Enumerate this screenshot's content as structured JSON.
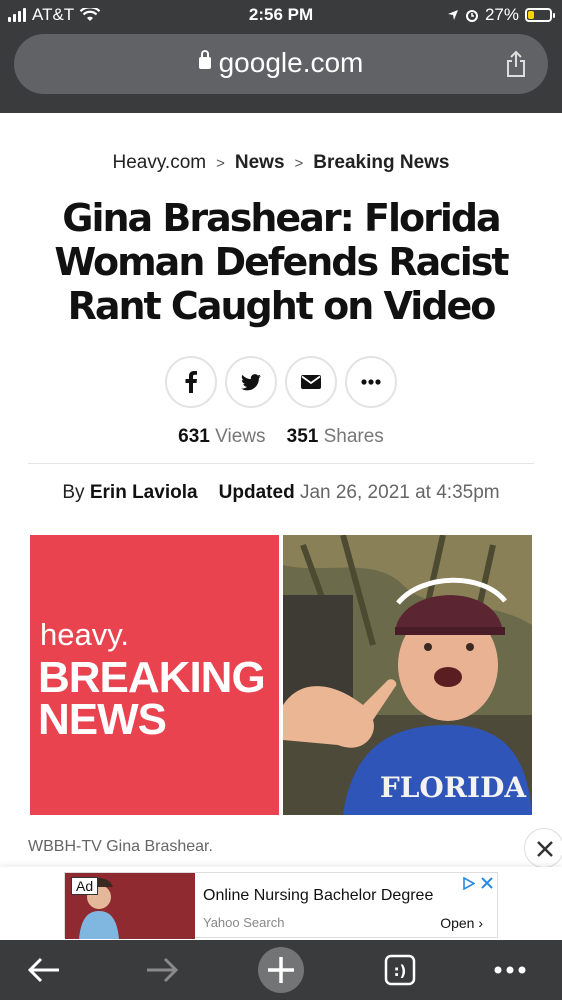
{
  "status_bar": {
    "carrier": "AT&T",
    "time": "2:56 PM",
    "battery": "27%",
    "battery_level": 0.27
  },
  "url_bar": {
    "domain": "google.com"
  },
  "article": {
    "breadcrumb": [
      "Heavy.com",
      "News",
      "Breaking News"
    ],
    "title": "Gina Brashear: Florida Woman Defends Racist Rant Caught on Video",
    "views_count": "631",
    "views_label": "Views",
    "shares_count": "351",
    "shares_label": "Shares",
    "by_label": "By",
    "author": "Erin Laviola",
    "updated_label": "Updated",
    "updated_date": "Jan 26, 2021 at 4:35pm",
    "image_left": {
      "brand": "heavy.",
      "line1": "BREAKING",
      "line2": "NEWS"
    },
    "image_right_shirt_text": "FLORIDA",
    "caption": "WBBH-TV Gina Brashear."
  },
  "ad": {
    "badge": "Ad",
    "title": "Online Nursing Bachelor Degree",
    "source": "Yahoo Search",
    "open_label": "Open"
  },
  "colors": {
    "chrome": "#3a3b3d",
    "url_pill": "#616265",
    "heavy_red": "#e8434f",
    "battery_yellow": "#f5d400"
  },
  "icons": {
    "share": "share-icon",
    "facebook": "facebook-icon",
    "twitter": "twitter-icon",
    "email": "email-icon",
    "more": "more-icon",
    "back": "back-arrow-icon",
    "forward": "forward-arrow-icon",
    "new_tab": "plus-icon",
    "tabs": "tabs-icon",
    "menu": "menu-dots-icon"
  }
}
